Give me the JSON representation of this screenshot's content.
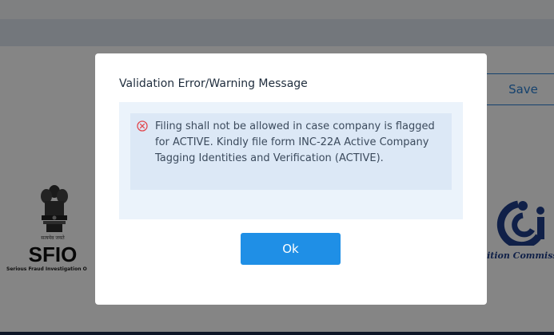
{
  "background": {
    "save_label": "Save",
    "sfio": {
      "motto": "सत्यमेव जयते",
      "title": "SFIO",
      "subtitle": "Serious Fraud Investigation O"
    },
    "cci": {
      "text": "tition Commission"
    }
  },
  "modal": {
    "title": "Validation Error/Warning Message",
    "messages": [
      {
        "icon": "error-circle-x-icon",
        "text": "Filing shall not be allowed in case company is flagged for ACTIVE. Kindly file form INC-22A Active Company Tagging Identities and Verification (ACTIVE)."
      }
    ],
    "ok_label": "Ok"
  },
  "colors": {
    "primary": "#1f8fe6",
    "error": "#e2474d",
    "panel_bg": "#ebf3fb",
    "message_bg": "#dce8f6",
    "footer": "#1b2b4a"
  }
}
